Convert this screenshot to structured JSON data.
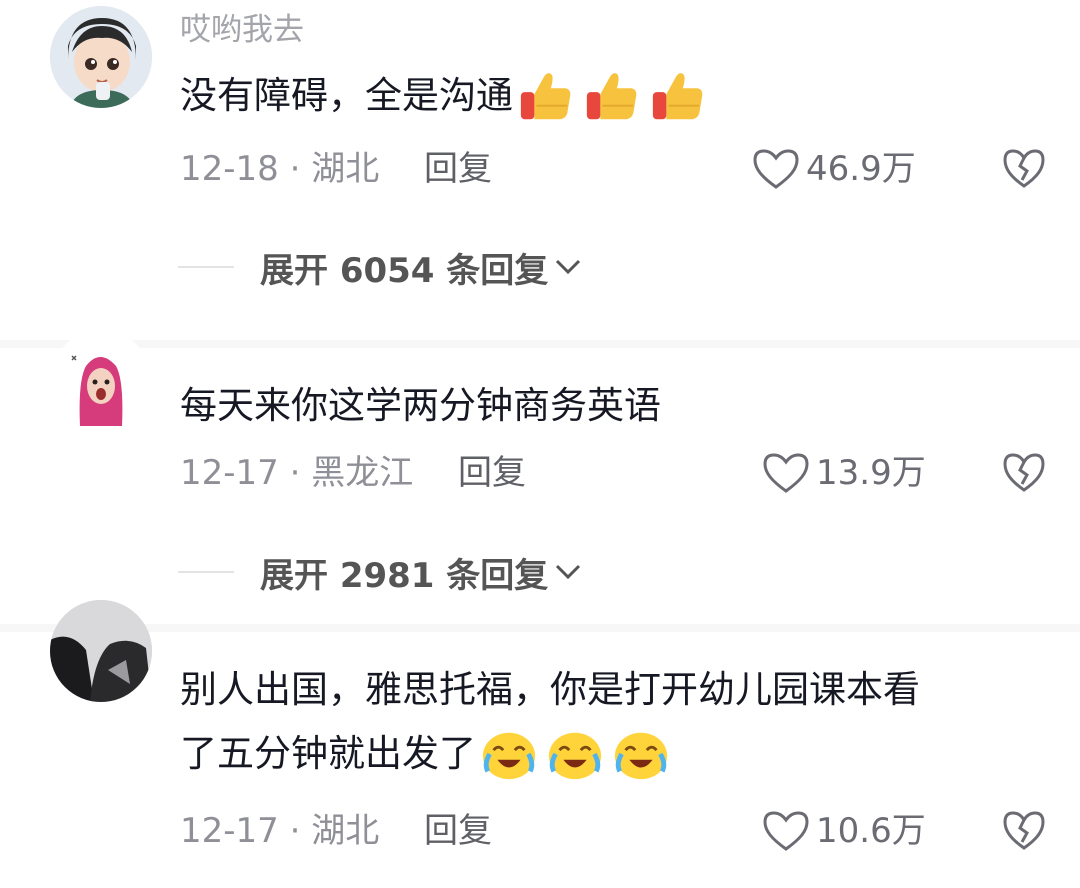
{
  "comments": [
    {
      "username": "哎哟我去",
      "lines": [
        "没有障碍，全是沟通"
      ],
      "emoji": "thumbs-up-icon",
      "date_location": "12-18 · 湖北",
      "reply_label": "回复",
      "likes": "46.9万",
      "expand": {
        "text": "展开 6054 条回复"
      }
    },
    {
      "username": "",
      "lines": [
        "每天来你这学两分钟商务英语"
      ],
      "date_location": "12-17 · 黑龙江",
      "reply_label": "回复",
      "likes": "13.9万",
      "expand": {
        "text": "展开 2981 条回复"
      }
    },
    {
      "username": "",
      "lines": [
        "别人出国，雅思托福，你是打开幼儿园课本看",
        "了五分钟就出发了"
      ],
      "emoji": "laugh-cry-icon",
      "date_location": "12-17 · 湖北",
      "reply_label": "回复",
      "likes": "10.6万"
    }
  ],
  "colors": {
    "text": "#161823",
    "meta": "#8f9097",
    "username": "#a4a5ab",
    "thumb": "#f7c33f",
    "emoji_face": "#ffd43b"
  }
}
